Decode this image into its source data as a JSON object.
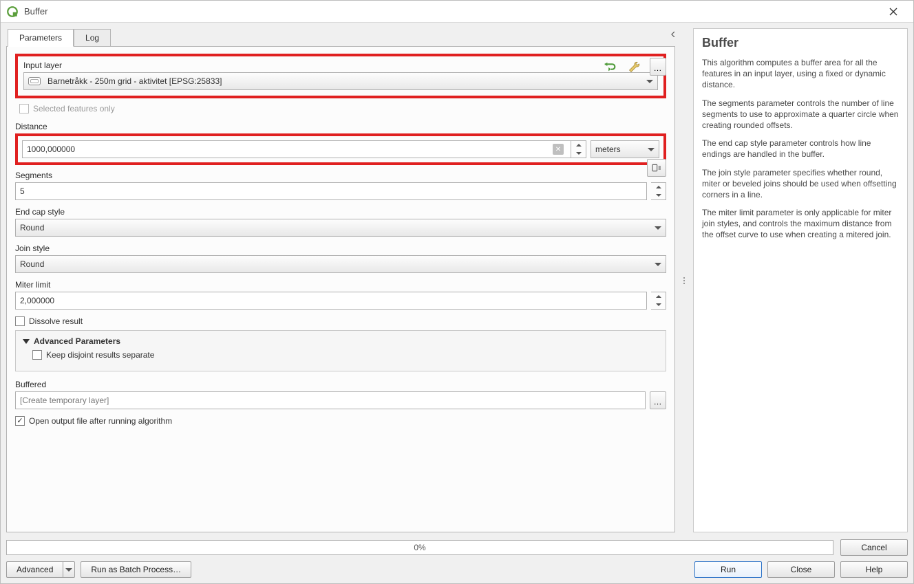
{
  "window": {
    "title": "Buffer"
  },
  "tabs": {
    "parameters": "Parameters",
    "log": "Log"
  },
  "inputLayer": {
    "label": "Input layer",
    "value": "Barnetråkk - 250m grid - aktivitet [EPSG:25833]",
    "selectedOnly": "Selected features only"
  },
  "distance": {
    "label": "Distance",
    "value": "1000,000000",
    "unit": "meters"
  },
  "segments": {
    "label": "Segments",
    "value": "5"
  },
  "endcap": {
    "label": "End cap style",
    "value": "Round"
  },
  "joinstyle": {
    "label": "Join style",
    "value": "Round"
  },
  "miter": {
    "label": "Miter limit",
    "value": "2,000000"
  },
  "dissolve": {
    "label": "Dissolve result"
  },
  "advanced": {
    "title": "Advanced Parameters",
    "disjoint": "Keep disjoint results separate"
  },
  "buffered": {
    "label": "Buffered",
    "placeholder": "[Create temporary layer]"
  },
  "openOutput": {
    "label": "Open output file after running algorithm"
  },
  "progress": {
    "text": "0%"
  },
  "buttons": {
    "advanced": "Advanced",
    "batch": "Run as Batch Process…",
    "cancel": "Cancel",
    "run": "Run",
    "close": "Close",
    "help": "Help"
  },
  "help": {
    "title": "Buffer",
    "p1": "This algorithm computes a buffer area for all the features in an input layer, using a fixed or dynamic distance.",
    "p2": "The segments parameter controls the number of line segments to use to approximate a quarter circle when creating rounded offsets.",
    "p3": "The end cap style parameter controls how line endings are handled in the buffer.",
    "p4": "The join style parameter specifies whether round, miter or beveled joins should be used when offsetting corners in a line.",
    "p5": "The miter limit parameter is only applicable for miter join styles, and controls the maximum distance from the offset curve to use when creating a mitered join."
  }
}
